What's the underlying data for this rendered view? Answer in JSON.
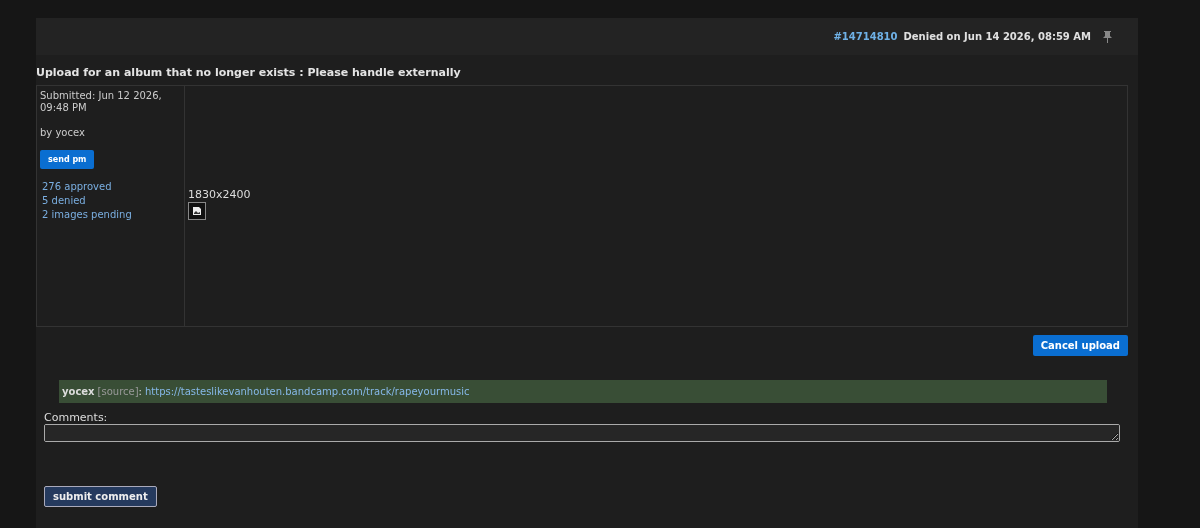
{
  "header": {
    "id_link": "#14714810",
    "status": "Denied on Jun 14 2026, 08:59 AM"
  },
  "title": "Upload for an album that no longer exists : Please handle externally",
  "submitter": {
    "submitted": "Submitted: Jun 12 2026, 09:48 PM",
    "by": "by yocex",
    "button": "send pm",
    "stats": [
      "276 approved",
      "5 denied",
      "2 images pending"
    ]
  },
  "image": {
    "dimensions": "1830x2400"
  },
  "cancel_button": "Cancel upload",
  "source_note": {
    "user": "yocex",
    "tag": "[source]",
    "separator": ":",
    "url": "https://tasteslikevanhouten.bandcamp.com/track/rapeyourmusic"
  },
  "comments": {
    "label": "Comments:"
  },
  "submit_button": "submit comment"
}
